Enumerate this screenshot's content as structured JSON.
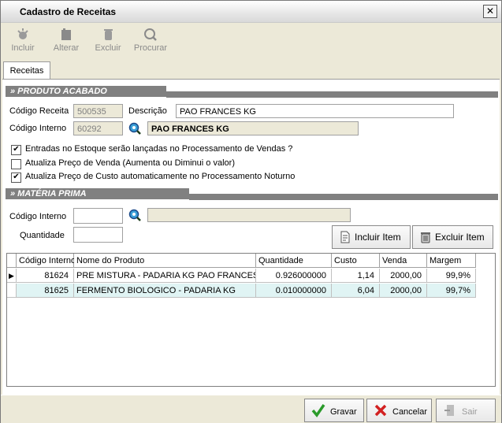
{
  "window": {
    "title": "Cadastro de Receitas",
    "close_label": "✕"
  },
  "toolbar": {
    "items": [
      {
        "label": "Incluir",
        "icon": "add-icon"
      },
      {
        "label": "Alterar",
        "icon": "edit-icon"
      },
      {
        "label": "Excluir",
        "icon": "delete-icon"
      },
      {
        "label": "Procurar",
        "icon": "search-icon"
      }
    ]
  },
  "tabs": [
    {
      "label": "Receitas"
    }
  ],
  "produto_acabado": {
    "header": "» PRODUTO ACABADO",
    "codigo_receita_label": "Código Receita",
    "codigo_receita_value": "500535",
    "descricao_label": "Descrição",
    "descricao_value": "PAO FRANCES KG",
    "codigo_interno_label": "Código Interno",
    "codigo_interno_value": "60292",
    "produto_nome": "PAO FRANCES KG"
  },
  "options": [
    {
      "label": "Entradas no Estoque serão lançadas no Processamento de Vendas ?",
      "checked": true
    },
    {
      "label": "Atualiza Preço de Venda (Aumenta ou Diminui o valor)",
      "checked": false
    },
    {
      "label": "Atualiza Preço de Custo automaticamente no Processamento Noturno",
      "checked": true
    }
  ],
  "materia_prima": {
    "header": "» MATÉRIA PRIMA",
    "codigo_interno_label": "Código Interno",
    "quantidade_label": "Quantidade",
    "incluir_item_label": "Incluir Item",
    "excluir_item_label": "Excluir Item"
  },
  "grid": {
    "columns": [
      "Código Interno",
      "Nome do Produto",
      "Quantidade",
      "Custo",
      "Venda",
      "Margem"
    ],
    "rows": [
      {
        "codigo": "81624",
        "nome": "PRE MISTURA - PADARIA KG  PAO FRANCES",
        "quantidade": "0.926000000",
        "custo": "1,14",
        "venda": "2000,00",
        "margem": "99,9%"
      },
      {
        "codigo": "81625",
        "nome": "FERMENTO BIOLOGICO - PADARIA KG",
        "quantidade": "0.010000000",
        "custo": "6,04",
        "venda": "2000,00",
        "margem": "99,7%"
      }
    ]
  },
  "footer": {
    "gravar_label": "Gravar",
    "cancelar_label": "Cancelar",
    "sair_label": "Sair"
  },
  "colors": {
    "section_header": "#808080",
    "selected_row": "#e0f4f4",
    "window_bg": "#ece9d8"
  }
}
